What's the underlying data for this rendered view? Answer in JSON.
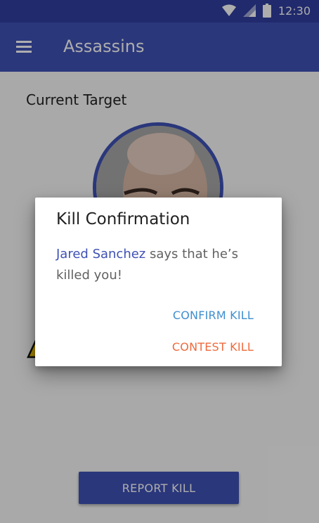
{
  "status_bar": {
    "time": "12:30",
    "icons": [
      "wifi-icon",
      "signal-icon",
      "battery-icon"
    ]
  },
  "app_bar": {
    "menu_icon": "menu-icon",
    "title": "Assassins"
  },
  "main": {
    "current_target_label": "Current Target",
    "report_button_label": "REPORT KILL"
  },
  "dialog": {
    "title": "Kill Confirmation",
    "killer_name": "Jared Sanchez",
    "message_rest": " says that he’s killed you!",
    "confirm_label": "CONFIRM KILL",
    "contest_label": "CONTEST KILL"
  },
  "colors": {
    "primary": "#3f51b5",
    "primary_dark": "#303f9f",
    "confirm": "#3f8fd0",
    "contest": "#ef6a3c"
  }
}
